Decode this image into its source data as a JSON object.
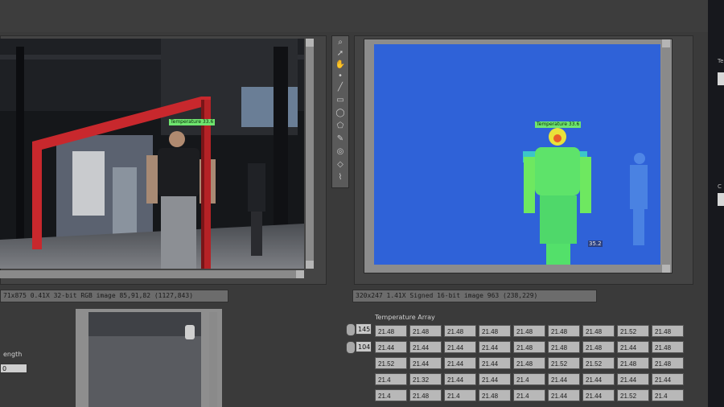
{
  "rgb_view": {
    "status": "71x875 0.41X 32-bit RGB image 85,91,82  (1127,843)",
    "overlay_label": "Temperature 33.6"
  },
  "thermal_view": {
    "status": "320x247 1.41X Signed 16-bit image 963    (238,229)",
    "overlay_label": "Temperature 33.6",
    "corner_value": "35.2"
  },
  "temperature_array": {
    "title": "Temperature Array",
    "index_1": "145",
    "index_2": "104",
    "rows": [
      [
        "21.48",
        "21.48",
        "21.48",
        "21.48",
        "21.48",
        "21.48",
        "21.48",
        "21.52",
        "21.48"
      ],
      [
        "21.44",
        "21.44",
        "21.44",
        "21.44",
        "21.48",
        "21.48",
        "21.48",
        "21.44",
        "21.48"
      ],
      [
        "21.52",
        "21.44",
        "21.44",
        "21.44",
        "21.48",
        "21.52",
        "21.52",
        "21.48",
        "21.48"
      ],
      [
        "21.4",
        "21.32",
        "21.44",
        "21.44",
        "21.4",
        "21.44",
        "21.44",
        "21.44",
        "21.44"
      ],
      [
        "21.4",
        "21.48",
        "21.4",
        "21.48",
        "21.4",
        "21.44",
        "21.44",
        "21.52",
        "21.4"
      ]
    ]
  },
  "left_panel": {
    "label": "ength",
    "value": "0"
  },
  "right_strip": {
    "label_top": "Te",
    "label_bottom": "C"
  },
  "colors": {
    "thermal_bg": "#2f62d8",
    "thermal_subject": "#5ee36a",
    "frame_red": "#c8282d"
  }
}
